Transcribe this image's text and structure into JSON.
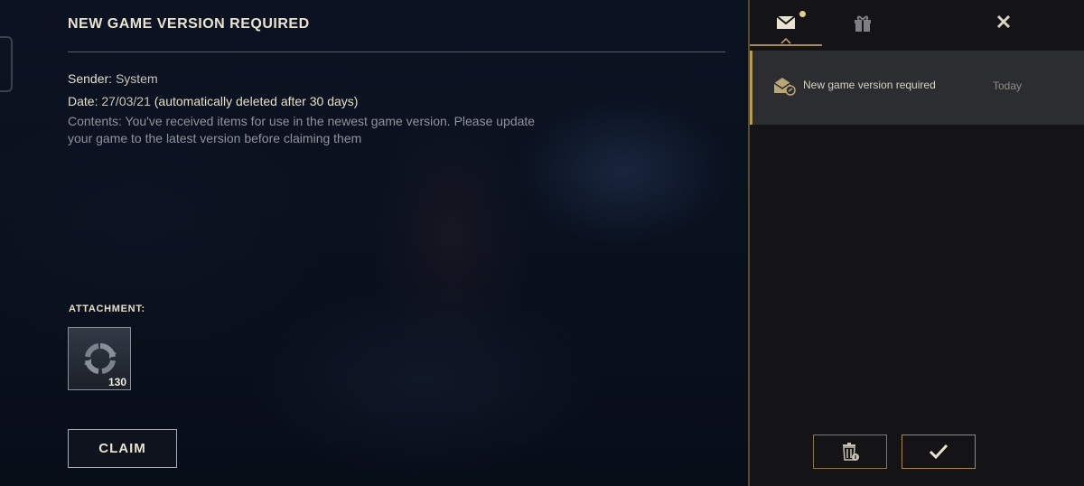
{
  "detail": {
    "title": "NEW GAME VERSION REQUIRED",
    "sender_label": "Sender:",
    "sender_value": "System",
    "date_label": "Date:",
    "date_value": "27/03/21",
    "date_note": "(automatically deleted after 30 days)",
    "contents": "Contents: You've received items for use in the newest game version. Please update your game to the latest version before claiming them",
    "attachment_label": "ATTACHMENT:",
    "attachment": {
      "icon": "refresh-icon",
      "count": "130"
    },
    "claim_label": "CLAIM"
  },
  "mailbox": {
    "tabs": [
      {
        "icon": "mail-icon",
        "active": true,
        "has_notification": true
      },
      {
        "icon": "gift-icon",
        "active": false,
        "has_notification": false
      }
    ],
    "close_icon": "close-icon",
    "items": [
      {
        "icon": "opened-mail-icon",
        "subject": "New game version required",
        "date": "Today",
        "selected": true
      }
    ],
    "actions": [
      {
        "icon": "trash-icon"
      },
      {
        "icon": "checkmark-icon"
      }
    ]
  },
  "colors": {
    "accent_gold": "#c8aa6e",
    "title_text": "#eae3d1",
    "panel_bg": "#141416",
    "selected_row_bg": "#2b2d31",
    "notification_dot": "#e9c98a"
  }
}
